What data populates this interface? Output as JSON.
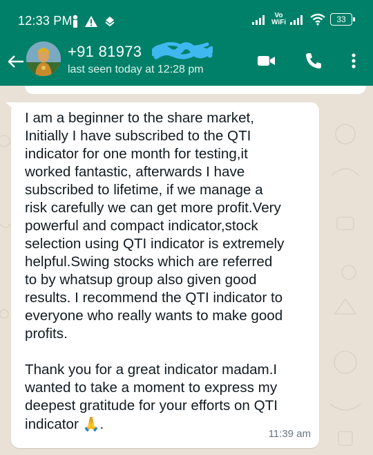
{
  "status_bar": {
    "time": "12:33 PM",
    "left_icons": [
      "person-icon",
      "warning-icon",
      "sync-icon"
    ],
    "network_label_top": "Vo",
    "network_label_bottom": "WiFi",
    "battery_level": "33"
  },
  "header": {
    "contact_name": "+91 81973",
    "last_seen": "last seen today at 12:28 pm",
    "actions": [
      "video-call-icon",
      "phone-icon",
      "more-options-icon"
    ]
  },
  "colors": {
    "header_bg": "#008069",
    "chat_bg": "#e9e1d6",
    "bubble_bg": "#ffffff",
    "redaction": "#3fb8f0"
  },
  "message": {
    "paragraph1": "I am a beginner to the share market,\nInitially I have subscribed to the QTI\nindicator for one month for testing,it\nworked fantastic, afterwards I have\nsubscribed to lifetime,  if we manage a\nrisk carefully we can get more profit.Very\npowerful and compact indicator,stock\nselection using QTI indicator is extremely\nhelpful.Swing stocks which are referred\nto by whatsup group also given good\nresults. I recommend the QTI indicator to\neveryone who really wants to make good\nprofits.",
    "paragraph2": "Thank you for a great indicator madam.I\nwanted to take a moment to express my\ndeepest gratitude for your efforts on QTI\nindicator",
    "emoji": "🙏",
    "trailing": ".",
    "time": "11:39 am"
  }
}
